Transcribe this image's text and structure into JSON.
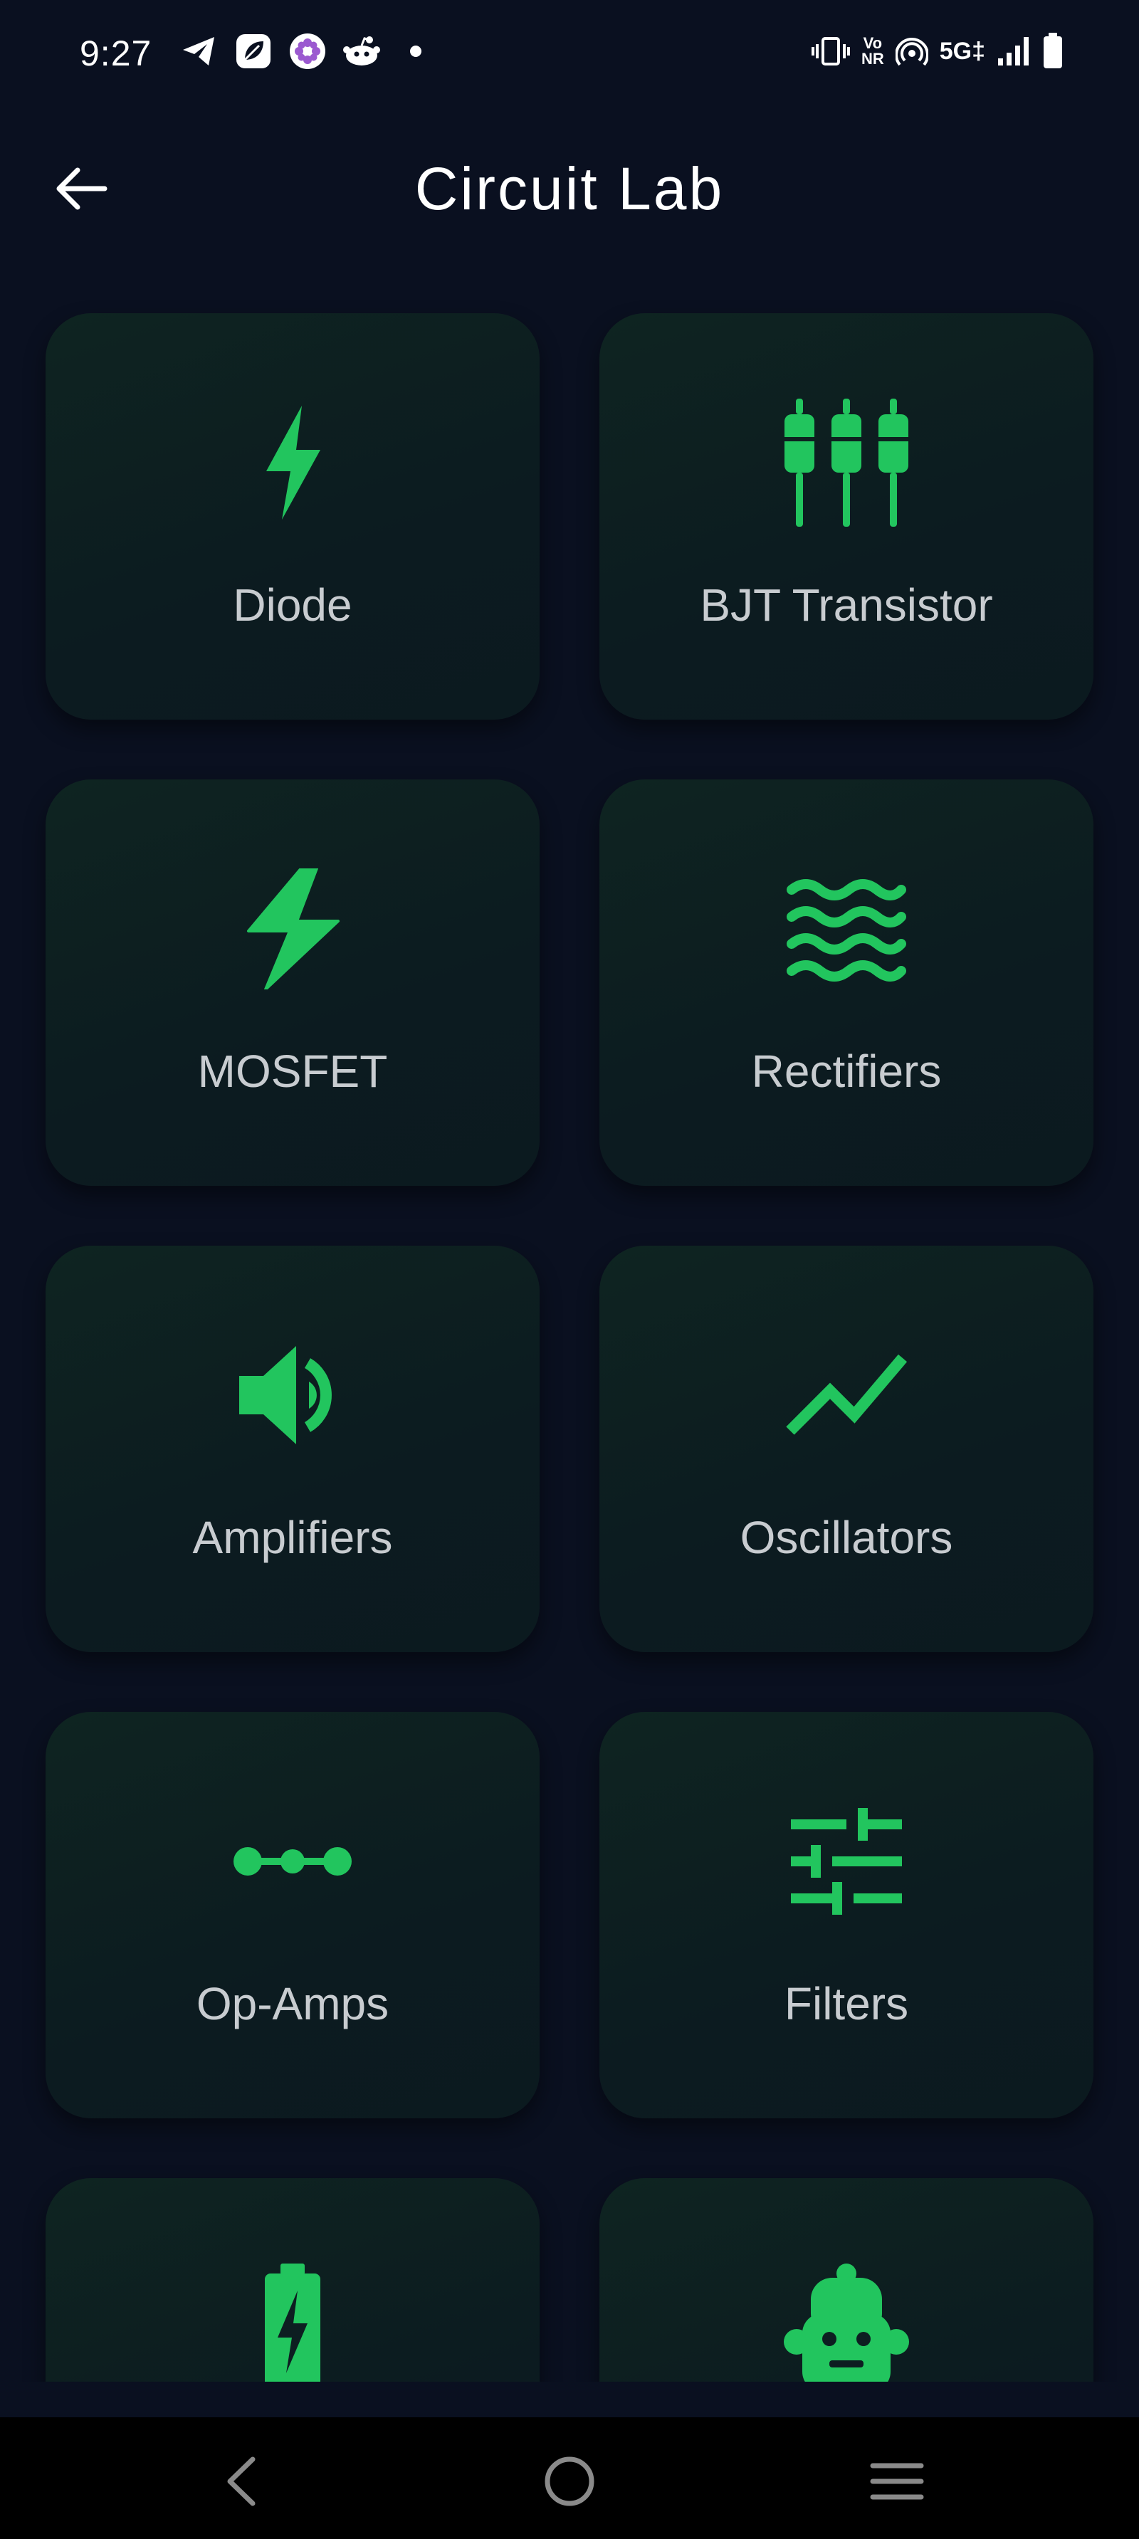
{
  "status_bar": {
    "time": "9:27",
    "left_icons": [
      "telegram-icon",
      "app-leaf-icon",
      "app-flower-icon",
      "reddit-icon",
      "dot-icon"
    ],
    "right_icons": [
      "vibrate-icon",
      "vonr-icon",
      "hotspot-icon",
      "network-5g-icon",
      "signal-icon",
      "battery-icon"
    ],
    "vonr_line1": "Vo",
    "vonr_line2": "NR",
    "network": "5G‡"
  },
  "app_bar": {
    "title": "Circuit Lab",
    "back_icon": "arrow-left-icon"
  },
  "colors": {
    "background": "#0a1020",
    "card": "#0d1e21",
    "accent": "#22c55e",
    "label": "#c8ccd0",
    "title": "#ffffff"
  },
  "cards": [
    {
      "label": "Diode",
      "icon": "bolt-icon"
    },
    {
      "label": "BJT Transistor",
      "icon": "resistors-icon"
    },
    {
      "label": "MOSFET",
      "icon": "flash-icon"
    },
    {
      "label": "Rectifiers",
      "icon": "waves-icon"
    },
    {
      "label": "Amplifiers",
      "icon": "speaker-icon"
    },
    {
      "label": "Oscillators",
      "icon": "trend-icon"
    },
    {
      "label": "Op-Amps",
      "icon": "dots-line-icon"
    },
    {
      "label": "Filters",
      "icon": "sliders-icon"
    },
    {
      "label": "",
      "icon": "battery-charging-icon"
    },
    {
      "label": "",
      "icon": "robot-icon"
    }
  ],
  "nav_bar": {
    "buttons": [
      "back-icon",
      "home-icon",
      "menu-icon"
    ]
  }
}
